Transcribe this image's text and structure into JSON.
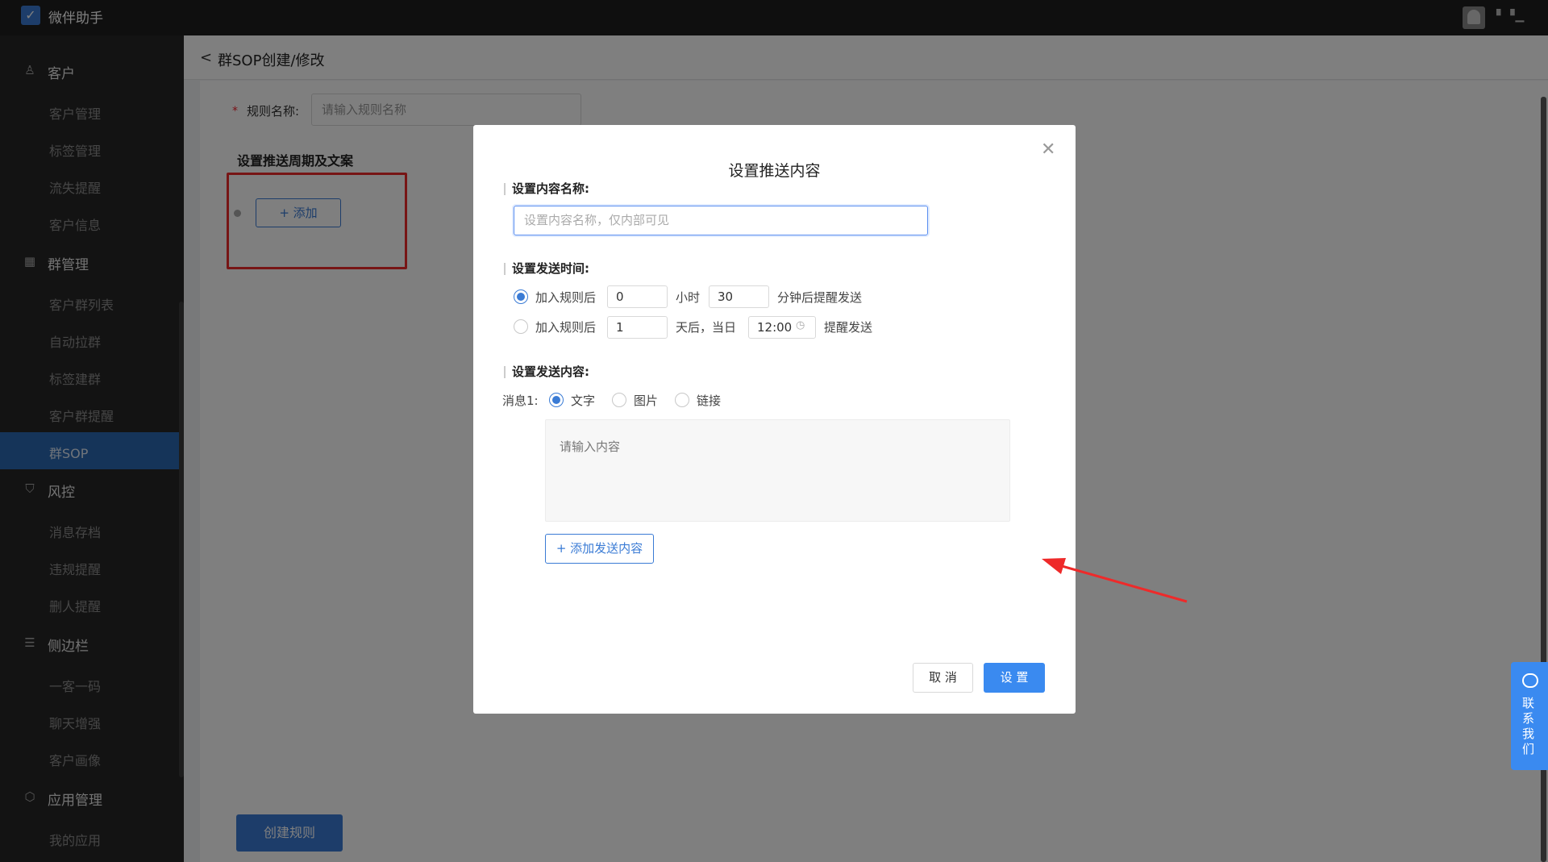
{
  "app": {
    "name": "微伴助手",
    "username": "▘▝▁"
  },
  "sidebar": {
    "groups": [
      {
        "label": "客户",
        "icon": "user-icon",
        "items": [
          "客户管理",
          "标签管理",
          "流失提醒",
          "客户信息"
        ]
      },
      {
        "label": "群管理",
        "icon": "grid-icon",
        "items": [
          "客户群列表",
          "自动拉群",
          "标签建群",
          "客户群提醒",
          "群SOP"
        ]
      },
      {
        "label": "风控",
        "icon": "shield-icon",
        "items": [
          "消息存档",
          "违规提醒",
          "删人提醒"
        ]
      },
      {
        "label": "侧边栏",
        "icon": "sidebar-icon",
        "items": [
          "一客一码",
          "聊天增强",
          "客户画像"
        ]
      },
      {
        "label": "应用管理",
        "icon": "cube-icon",
        "items": [
          "我的应用"
        ]
      }
    ],
    "active_item": "群SOP"
  },
  "page": {
    "title": "群SOP创建/修改",
    "rule_name_label": "规则名称:",
    "rule_name_placeholder": "请输入规则名称",
    "section_title": "设置推送周期及文案",
    "add_label": "+ 添加",
    "create_label": "创建规则"
  },
  "modal": {
    "title": "设置推送内容",
    "content_name_label": "设置内容名称:",
    "content_name_placeholder": "设置内容名称，仅内部可见",
    "send_time_label": "设置发送时间:",
    "option1": {
      "prefix": "加入规则后",
      "hours": "0",
      "hours_unit": "小时",
      "minutes": "30",
      "suffix": "分钟后提醒发送",
      "selected": true
    },
    "option2": {
      "prefix": "加入规则后",
      "days": "1",
      "days_unit": "天后，当日",
      "time": "12:00",
      "suffix": "提醒发送",
      "selected": false
    },
    "send_content_label": "设置发送内容:",
    "message_label": "消息1:",
    "message_types": [
      "文字",
      "图片",
      "链接"
    ],
    "selected_type": "文字",
    "content_placeholder": "请输入内容",
    "add_content_label": "+ 添加发送内容",
    "cancel_label": "取 消",
    "confirm_label": "设 置"
  },
  "contact": {
    "label": "联系我们"
  },
  "colors": {
    "primary": "#3a7bd5",
    "highlight": "#ee2a2a",
    "sidebar_bg": "#272727",
    "topbar_bg": "#1f1f1f"
  }
}
